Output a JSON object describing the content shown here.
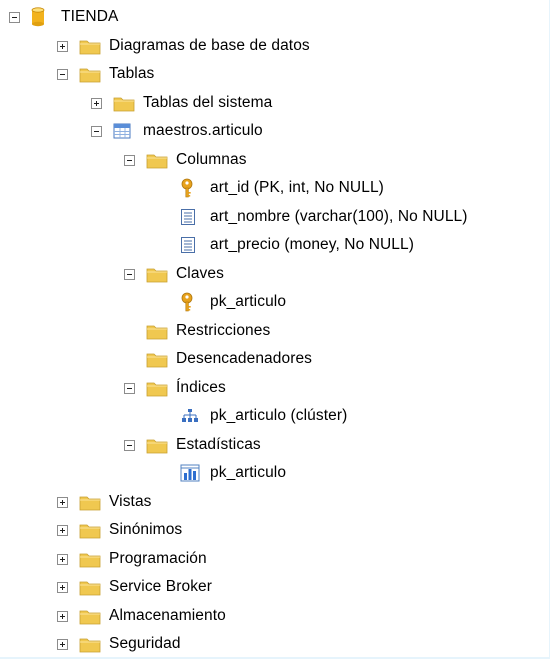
{
  "tree": {
    "root": {
      "label": "TIENDA",
      "icon": "database-icon"
    },
    "items": [
      {
        "label": "Diagramas de base de datos",
        "icon": "folder-icon",
        "expander": "plus"
      },
      {
        "label": "Tablas",
        "icon": "folder-icon",
        "expander": "minus"
      },
      {
        "label": "Tablas del sistema",
        "icon": "folder-icon",
        "expander": "plus"
      },
      {
        "label": "maestros.articulo",
        "icon": "table-icon",
        "expander": "minus"
      },
      {
        "label": "Columnas",
        "icon": "folder-icon",
        "expander": "minus"
      },
      {
        "label": "art_id (PK, int, No NULL)",
        "icon": "key-icon",
        "expander": "none"
      },
      {
        "label": "art_nombre (varchar(100), No NULL)",
        "icon": "column-icon",
        "expander": "none"
      },
      {
        "label": "art_precio (money, No NULL)",
        "icon": "column-icon",
        "expander": "none"
      },
      {
        "label": "Claves",
        "icon": "folder-icon",
        "expander": "minus"
      },
      {
        "label": "pk_articulo",
        "icon": "key-icon",
        "expander": "none"
      },
      {
        "label": "Restricciones",
        "icon": "folder-icon",
        "expander": "none"
      },
      {
        "label": "Desencadenadores",
        "icon": "folder-icon",
        "expander": "none"
      },
      {
        "label": "Índices",
        "icon": "folder-icon",
        "expander": "minus"
      },
      {
        "label": "pk_articulo (clúster)",
        "icon": "index-icon",
        "expander": "none"
      },
      {
        "label": "Estadísticas",
        "icon": "folder-icon",
        "expander": "minus"
      },
      {
        "label": "pk_articulo",
        "icon": "statistics-icon",
        "expander": "none"
      },
      {
        "label": "Vistas",
        "icon": "folder-icon",
        "expander": "plus"
      },
      {
        "label": "Sinónimos",
        "icon": "folder-icon",
        "expander": "plus"
      },
      {
        "label": "Programación",
        "icon": "folder-icon",
        "expander": "plus"
      },
      {
        "label": "Service Broker",
        "icon": "folder-icon",
        "expander": "plus"
      },
      {
        "label": "Almacenamiento",
        "icon": "folder-icon",
        "expander": "plus"
      },
      {
        "label": "Seguridad",
        "icon": "folder-icon",
        "expander": "plus"
      }
    ]
  },
  "colors": {
    "background": "#e6f4fc",
    "folder": "#f0c850",
    "database": "#f2b21c",
    "key": "#e8a21c",
    "text": "#000000"
  }
}
